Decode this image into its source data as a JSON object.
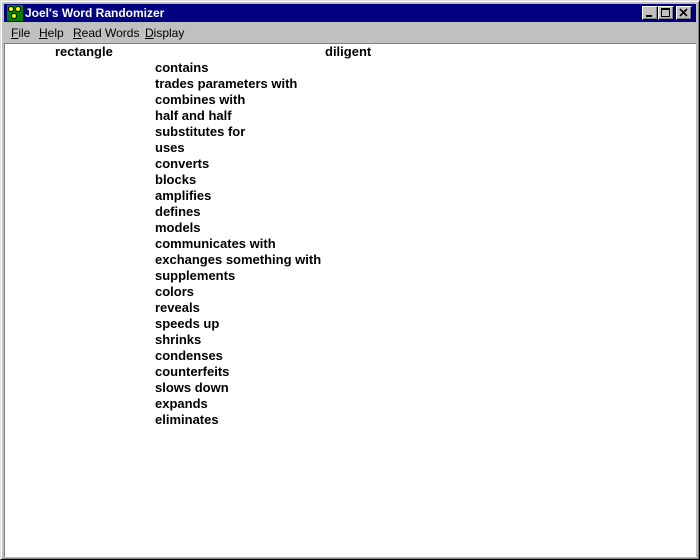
{
  "window": {
    "title": "Joel's Word Randomizer"
  },
  "menu": {
    "items": [
      {
        "label_underlined": "F",
        "label_rest": "ile"
      },
      {
        "label_underlined": "H",
        "label_rest": "elp"
      },
      {
        "label_underlined": "R",
        "label_rest": "ead Words"
      },
      {
        "label_underlined": "D",
        "label_rest": "isplay"
      }
    ]
  },
  "content": {
    "noun": "rectangle",
    "adjective": "diligent",
    "verbs": [
      "contains",
      "trades parameters with",
      "combines with",
      "half and half",
      "substitutes for",
      "uses",
      "converts",
      "blocks",
      "amplifies",
      "defines",
      "models",
      "communicates with",
      "exchanges something with",
      "supplements",
      "colors",
      "reveals",
      "speeds up",
      "shrinks",
      "condenses",
      "counterfeits",
      "slows down",
      "expands",
      "eliminates"
    ]
  },
  "icons": {
    "app": "app-icon",
    "minimize": "minimize-icon",
    "maximize": "maximize-icon",
    "close": "close-icon"
  },
  "colors": {
    "titlebar": "#000080",
    "face": "#c0c0c0",
    "client": "#ffffff",
    "icon_green": "#008000",
    "icon_yellow": "#ffff00"
  }
}
